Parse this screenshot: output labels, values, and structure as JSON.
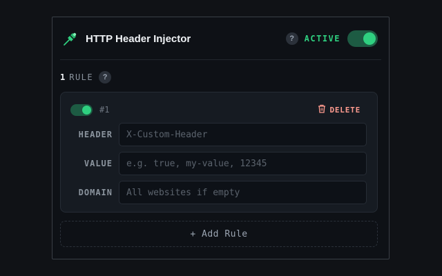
{
  "header": {
    "logo_icon": "pin-icon",
    "title": "HTTP Header Injector",
    "help_label": "?",
    "status_label": "ACTIVE",
    "enabled": true,
    "accent_color": "#2fd080"
  },
  "rules_summary": {
    "count": "1",
    "label": "RULE",
    "help_label": "?"
  },
  "rules": [
    {
      "enabled": true,
      "id_label": "#1",
      "delete_label": "DELETE",
      "delete_icon": "trash-icon",
      "fields": {
        "header": {
          "label": "HEADER",
          "value": "",
          "placeholder": "X-Custom-Header"
        },
        "value": {
          "label": "VALUE",
          "value": "",
          "placeholder": "e.g. true, my-value, 12345"
        },
        "domain": {
          "label": "DOMAIN",
          "value": "",
          "placeholder": "All websites if empty"
        }
      }
    }
  ],
  "add_rule_label": "+ Add Rule"
}
